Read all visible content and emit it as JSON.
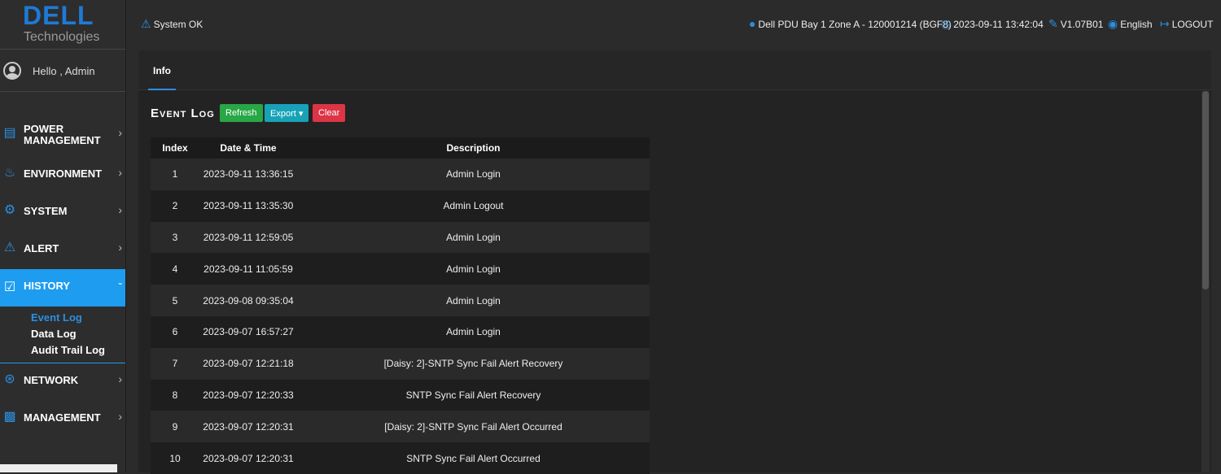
{
  "brand": {
    "name": "DELL",
    "subtitle": "Technologies"
  },
  "user": {
    "greeting": "Hello , Admin"
  },
  "topbar": {
    "status": "System OK",
    "location": "Dell PDU Bay 1 Zone A - 120001214 (BGF8)",
    "datetime": "2023-09-11 13:42:04",
    "version": "V1.07B01",
    "language": "English",
    "logout": "LOGOUT"
  },
  "nav": {
    "power_line1": "POWER",
    "power_line2": "MANAGEMENT",
    "environment": "ENVIRONMENT",
    "system": "SYSTEM",
    "alert": "ALERT",
    "history": "HISTORY",
    "network": "NETWORK",
    "management": "MANAGEMENT"
  },
  "history_sub": {
    "event_log": "Event Log",
    "data_log": "Data Log",
    "audit_trail_log": "Audit Trail Log"
  },
  "tabs": {
    "info": "Info"
  },
  "event_log": {
    "title": "Event Log",
    "buttons": {
      "refresh": "Refresh",
      "export": "Export ▾",
      "clear": "Clear"
    },
    "columns": [
      "Index",
      "Date & Time",
      "Description"
    ],
    "rows": [
      [
        "1",
        "2023-09-11 13:36:15",
        "Admin Login"
      ],
      [
        "2",
        "2023-09-11 13:35:30",
        "Admin Logout"
      ],
      [
        "3",
        "2023-09-11 12:59:05",
        "Admin Login"
      ],
      [
        "4",
        "2023-09-11 11:05:59",
        "Admin Login"
      ],
      [
        "5",
        "2023-09-08 09:35:04",
        "Admin Login"
      ],
      [
        "6",
        "2023-09-07 16:57:27",
        "Admin Login"
      ],
      [
        "7",
        "2023-09-07 12:21:18",
        "[Daisy: 2]-SNTP Sync Fail Alert Recovery"
      ],
      [
        "8",
        "2023-09-07 12:20:33",
        "SNTP Sync Fail Alert Recovery"
      ],
      [
        "9",
        "2023-09-07 12:20:31",
        "[Daisy: 2]-SNTP Sync Fail Alert Occurred"
      ],
      [
        "10",
        "2023-09-07 12:20:31",
        "SNTP Sync Fail Alert Occurred"
      ]
    ]
  },
  "colors": {
    "accent": "#1d9cf0",
    "refresh": "#28a745",
    "export": "#17a2b8",
    "clear": "#dc3545"
  }
}
